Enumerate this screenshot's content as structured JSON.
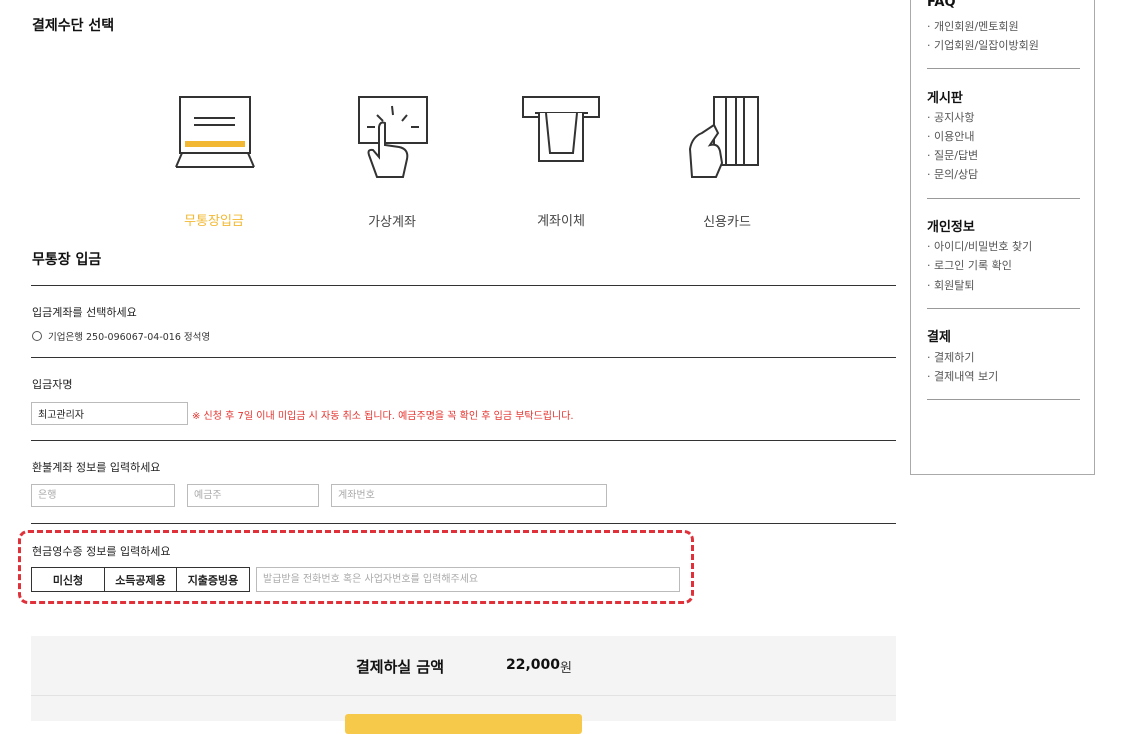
{
  "payment": {
    "title": "결제수단 선택",
    "methods": [
      {
        "label": "무통장입금",
        "icon": "laptop-icon",
        "active": true
      },
      {
        "label": "가상계좌",
        "icon": "touch-screen-icon",
        "active": false
      },
      {
        "label": "계좌이체",
        "icon": "atm-icon",
        "active": false
      },
      {
        "label": "신용카드",
        "icon": "credit-card-hand-icon",
        "active": false
      }
    ]
  },
  "deposit": {
    "title": "무통장 입금",
    "account_label": "입금계좌를 선택하세요",
    "account_option": "기업은행 250-096067-04-016 정석영",
    "depositor_label": "입금자명",
    "depositor_value": "최고관리자",
    "notice": "※ 신청 후 7일 이내 미입금 시 자동 취소 됩니다. 예금주명을 꼭 확인 후 입금 부탁드립니다."
  },
  "refund": {
    "label": "환불계좌 정보를 입력하세요",
    "bank_placeholder": "은행",
    "holder_placeholder": "예금주",
    "account_placeholder": "계좌번호"
  },
  "receipt": {
    "label": "현금영수증 정보를 입력하세요",
    "options": [
      "미신청",
      "소득공제용",
      "지출증빙용"
    ],
    "placeholder": "발급받을 전화번호 혹은 사업자번호를 입력해주세요"
  },
  "total": {
    "label": "결제하실 금액",
    "amount": "22,000",
    "unit": "원"
  },
  "sidebar": {
    "faq": {
      "heading": "FAQ",
      "items": [
        "· 개인회원/멘토회원",
        "· 기업회원/일잡이방회원"
      ]
    },
    "board": {
      "heading": "게시판",
      "items": [
        "· 공지사항",
        "· 이용안내",
        "· 질문/답변",
        "· 문의/상담"
      ]
    },
    "privacy": {
      "heading": "개인정보",
      "items": [
        "· 아이디/비밀번호 찾기",
        "· 로그인 기록 확인",
        "· 회원탈퇴"
      ]
    },
    "pay": {
      "heading": "결제",
      "items": [
        "· 결제하기",
        "· 결제내역 보기"
      ]
    }
  },
  "colors": {
    "accent": "#f2b834",
    "notice": "#e5322d",
    "highlight": "#e0313a",
    "button": "#f7c94b"
  }
}
